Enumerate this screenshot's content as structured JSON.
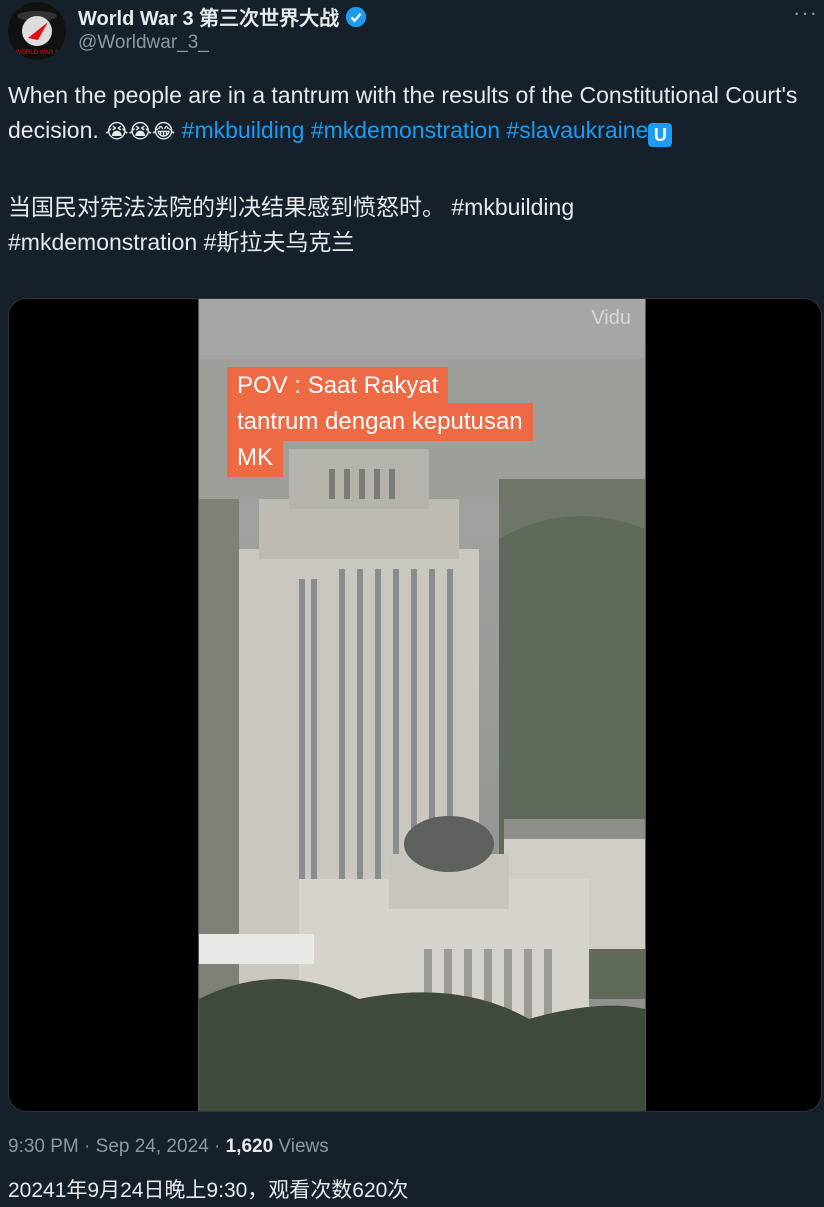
{
  "author": {
    "display_name": "World War 3 第三次世界大战",
    "handle": "@Worldwar_3_",
    "avatar_text": "WORLD WAR 3"
  },
  "tweet": {
    "text_en": "When the people are in a tantrum with the results of the Constitutional Court's decision.",
    "emojis": "😭😭😂",
    "hashtags_en": [
      "#mkbuilding",
      "#mkdemonstration",
      "#slavaukraine"
    ],
    "badge": "U",
    "text_cn": "当国民对宪法法院的判决结果感到愤怒时。",
    "hashtags_cn": [
      "#mkbuilding",
      "#mkdemonstration",
      "#斯拉夫乌克兰"
    ]
  },
  "video": {
    "watermark": "Vidu",
    "overlay_lines": [
      "POV : Saat Rakyat",
      "tantrum dengan keputusan",
      "MK"
    ]
  },
  "meta": {
    "time": "9:30 PM",
    "date": "Sep 24, 2024",
    "views_count": "1,620",
    "views_label": "Views",
    "cn_line": "20241年9月24日晚上9:30，观看次数620次"
  },
  "colors": {
    "background": "#15202b",
    "link": "#1d9bf0",
    "overlay": "#ee6a45"
  }
}
